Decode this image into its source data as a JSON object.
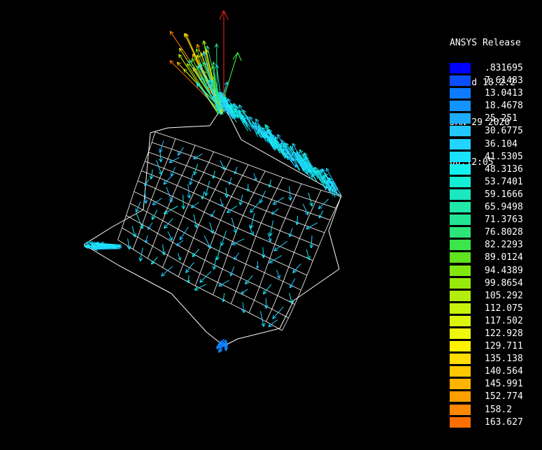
{
  "window": {
    "background": "#000000"
  },
  "info": {
    "release": "ANSYS Release",
    "build": "Build 18.2.2",
    "date": "JAN 29 2020",
    "time": "00:12:05"
  },
  "legend": {
    "items": [
      {
        "label": ".831695",
        "color": "#0000ff"
      },
      {
        "label": "7.61483",
        "color": "#0a4fff"
      },
      {
        "label": "13.0413",
        "color": "#0d7bff"
      },
      {
        "label": "18.4678",
        "color": "#1393ff"
      },
      {
        "label": "25.251",
        "color": "#1cadff"
      },
      {
        "label": "30.6775",
        "color": "#22c7ff"
      },
      {
        "label": "36.104",
        "color": "#22d4ff"
      },
      {
        "label": "41.5305",
        "color": "#19e2ff"
      },
      {
        "label": "48.3136",
        "color": "#13f0f0"
      },
      {
        "label": "53.7401",
        "color": "#13eed4"
      },
      {
        "label": "59.1666",
        "color": "#1ae8bf"
      },
      {
        "label": "65.9498",
        "color": "#1fe8a8"
      },
      {
        "label": "71.3763",
        "color": "#21e593"
      },
      {
        "label": "76.8028",
        "color": "#2be578"
      },
      {
        "label": "82.2293",
        "color": "#3be54a"
      },
      {
        "label": "89.0124",
        "color": "#5ee31c"
      },
      {
        "label": "94.4389",
        "color": "#80e80d"
      },
      {
        "label": "99.8654",
        "color": "#98ea0c"
      },
      {
        "label": "105.292",
        "color": "#b2ee0c"
      },
      {
        "label": "112.075",
        "color": "#c8f20c"
      },
      {
        "label": "117.502",
        "color": "#dcf50c"
      },
      {
        "label": "122.928",
        "color": "#eef80c"
      },
      {
        "label": "129.711",
        "color": "#fff200"
      },
      {
        "label": "135.138",
        "color": "#ffdd00"
      },
      {
        "label": "140.564",
        "color": "#ffc800"
      },
      {
        "label": "145.991",
        "color": "#ffb400"
      },
      {
        "label": "152.774",
        "color": "#ff9e00"
      },
      {
        "label": "158.2",
        "color": "#ff8800"
      },
      {
        "label": "163.627",
        "color": "#ff6e00"
      }
    ]
  }
}
